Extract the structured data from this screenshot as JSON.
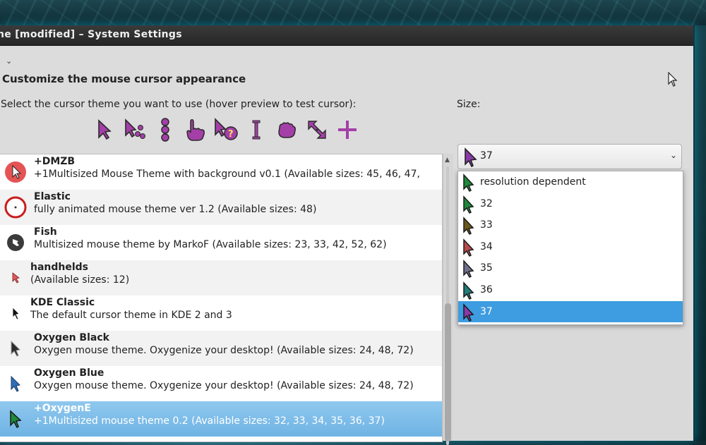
{
  "window": {
    "title": "ne [modified] – System Settings",
    "toolbar_chevron": "⌄"
  },
  "panel": {
    "heading": "Customize the mouse cursor appearance",
    "select_label": "Select the cursor theme you want to use (hover preview to test cursor):",
    "size_label": "Size:"
  },
  "preview_icons": [
    "arrow-cursor-icon",
    "busy-arrow-cursor-icon",
    "wait-cursor-icon",
    "hand-cursor-icon",
    "help-cursor-icon",
    "text-cursor-icon",
    "grab-cursor-icon",
    "resize-cursor-icon",
    "crosshair-cursor-icon"
  ],
  "themes": [
    {
      "name": "+DMZB",
      "desc": "+1Multisized Mouse Theme with background v0.1 (Available sizes: 45, 46, 47,"
    },
    {
      "name": "Elastic",
      "desc": "fully animated mouse theme ver 1.2 (Available sizes: 48)"
    },
    {
      "name": "Fish",
      "desc": "Multisized mouse theme by MarkoF (Available sizes: 23, 33, 42, 52, 62)"
    },
    {
      "name": "handhelds",
      "desc": "(Available sizes: 12)"
    },
    {
      "name": "KDE Classic",
      "desc": "The default cursor theme in KDE 2 and 3"
    },
    {
      "name": "Oxygen Black",
      "desc": "Oxygen mouse theme. Oxygenize your desktop! (Available sizes: 24, 48, 72)"
    },
    {
      "name": "Oxygen Blue",
      "desc": "Oxygen mouse theme. Oxygenize your desktop! (Available sizes: 24, 48, 72)"
    },
    {
      "name": "+OxygenE",
      "desc": "+1Multisized mouse theme 0.2 (Available sizes: 32, 33, 34, 35, 36, 37)"
    }
  ],
  "size_combo": {
    "value": "37",
    "chevron": "⌄",
    "options": [
      "resolution dependent",
      "32",
      "33",
      "34",
      "35",
      "36",
      "37"
    ],
    "selected_index": 6
  },
  "colors": {
    "accent": "#3e9ce0",
    "selection_row": "#7dbde9",
    "cursor_purple": "#a43fa8"
  }
}
